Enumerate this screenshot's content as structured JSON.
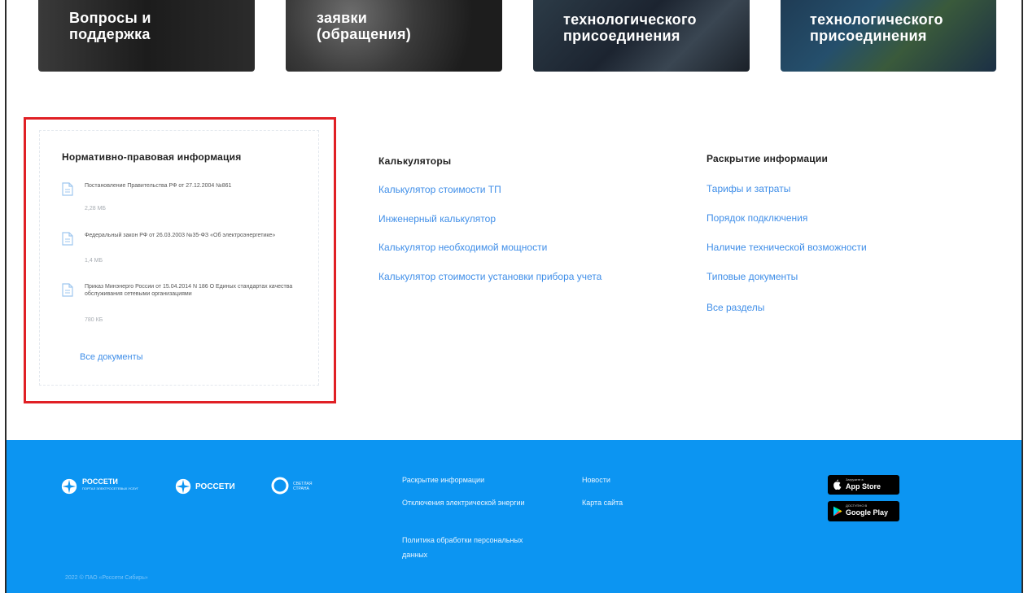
{
  "cards": [
    {
      "title": "Вопросы и\nподдержка"
    },
    {
      "title": "заявки\n(обращения)"
    },
    {
      "title": "технологического\nприсоединения"
    },
    {
      "title": "технологического\nприсоединения"
    }
  ],
  "documents": {
    "title": "Нормативно-правовая информация",
    "items": [
      {
        "name": "Постановление Правительства РФ от 27.12.2004 №861",
        "size": "2,28 МБ"
      },
      {
        "name": "Федеральный закон РФ от 26.03.2003 №35-ФЗ «Об электроэнергетике»",
        "size": "1,4 МБ"
      },
      {
        "name": "Приказ Минэнерго России от 15.04.2014 N 186 О Единых стандартах качества обслуживания сетевыми организациями",
        "size": "780 КБ"
      }
    ],
    "all_label": "Все документы"
  },
  "calculators": {
    "title": "Калькуляторы",
    "links": [
      "Калькулятор стоимости ТП",
      "Инженерный калькулятор",
      "Калькулятор необходимой мощности",
      "Калькулятор стоимости установки прибора учета"
    ]
  },
  "disclosure": {
    "title": "Раскрытие информации",
    "links": [
      "Тарифы и затраты",
      "Порядок подключения",
      "Наличие технической возможности",
      "Типовые документы",
      "Все разделы"
    ]
  },
  "footer": {
    "logo1": {
      "name": "РОССЕТИ",
      "sub": "ПОРТАЛ ЭЛЕКТРОСЕТЕВЫХ УСЛУГ"
    },
    "logo2": {
      "name": "РОССЕТИ"
    },
    "logo3": {
      "name": "СВЕТЛАЯ СТРАНА"
    },
    "links_col1": [
      "Раскрытие информации",
      "Отключения электрической энергии",
      "Политика обработки персональных данных"
    ],
    "links_col2": [
      "Новости",
      "Карта сайта"
    ],
    "appstore": {
      "small": "Загрузите в",
      "big": "App Store"
    },
    "googleplay": {
      "small": "ДОСТУПНО В",
      "big": "Google Play"
    },
    "copyright": "2022 © ПАО «Россети Сибирь»"
  },
  "colors": {
    "accent": "#0c95f2",
    "link": "#3f8ee8",
    "highlight": "#e02025"
  }
}
